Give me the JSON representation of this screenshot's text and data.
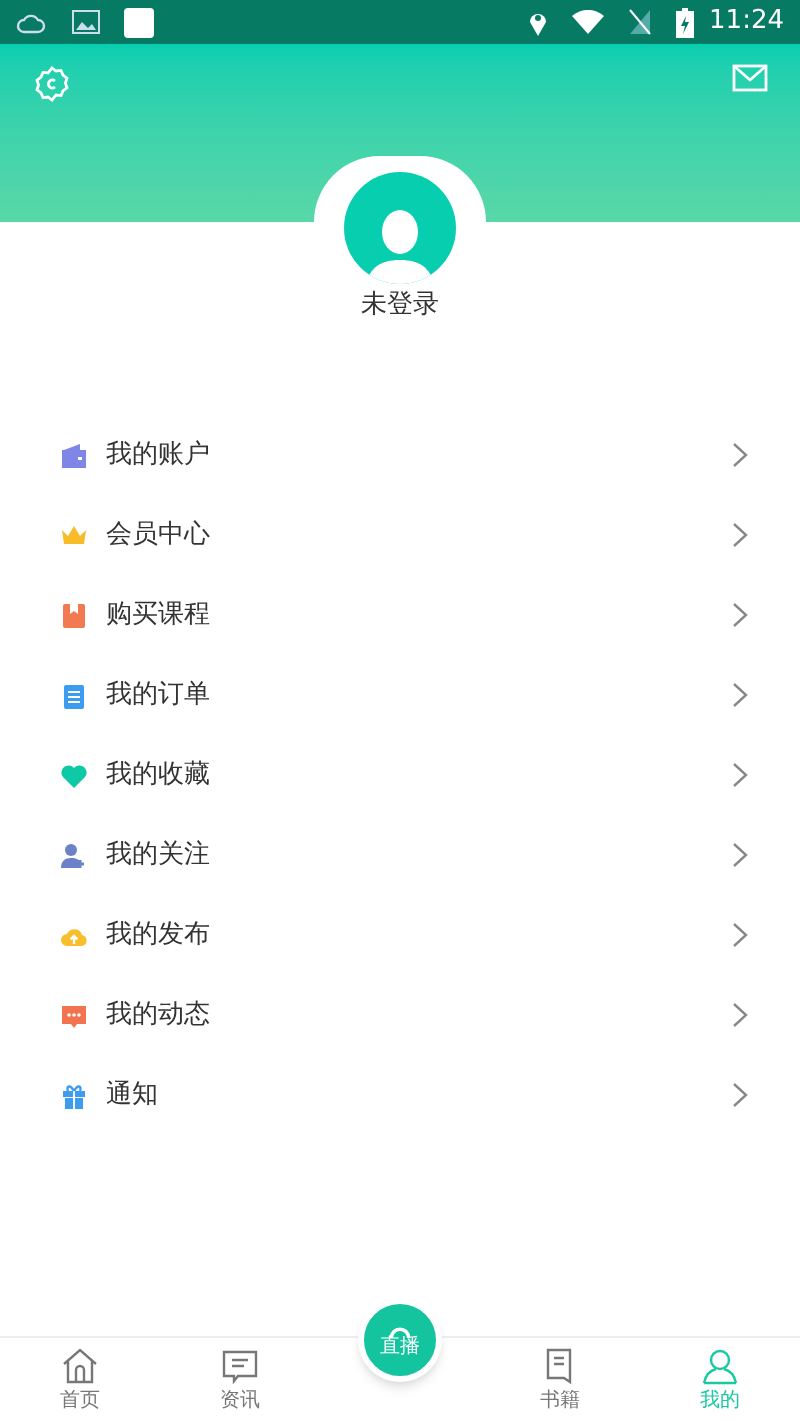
{
  "status_bar": {
    "time": "11:24"
  },
  "profile": {
    "name": "未登录"
  },
  "menu": [
    {
      "kind": "wallet",
      "label": "我的账户"
    },
    {
      "kind": "crown",
      "label": "会员中心"
    },
    {
      "kind": "book",
      "label": "购买课程"
    },
    {
      "kind": "clipboard",
      "label": "我的订单"
    },
    {
      "kind": "heart",
      "label": "我的收藏"
    },
    {
      "kind": "follow",
      "label": "我的关注"
    },
    {
      "kind": "upload",
      "label": "我的发布"
    },
    {
      "kind": "chat",
      "label": "我的动态"
    },
    {
      "kind": "gift",
      "label": "通知"
    }
  ],
  "bottom_nav": [
    {
      "kind": "home",
      "label": "首页",
      "selected": false
    },
    {
      "kind": "news",
      "label": "资讯",
      "selected": false
    },
    {
      "kind": "center",
      "label": "直播",
      "selected": false
    },
    {
      "kind": "books",
      "label": "书籍",
      "selected": false
    },
    {
      "kind": "me",
      "label": "我的",
      "selected": true
    }
  ]
}
